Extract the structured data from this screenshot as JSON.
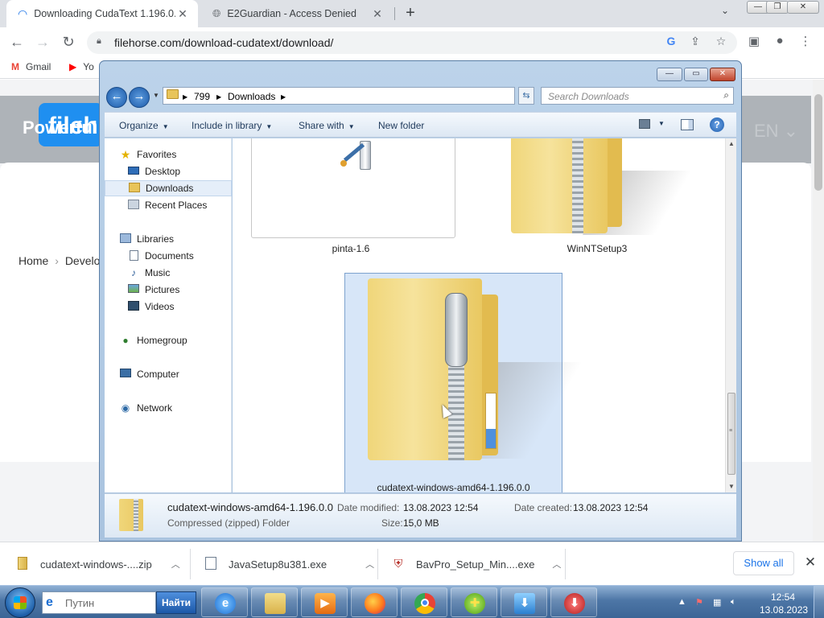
{
  "browser": {
    "tabs": [
      {
        "title": "Downloading CudaText 1.196.0.0",
        "close": "✕",
        "icon": "loading-spinner-icon"
      },
      {
        "title": "E2Guardian - Access Denied",
        "close": "✕",
        "icon": "globe-icon"
      }
    ],
    "new_tab": "+",
    "tab_dropdown": "⌄",
    "window_controls": {
      "minimize": "—",
      "maximize": "❐",
      "close": "✕"
    },
    "nav": {
      "back": "←",
      "forward": "→",
      "reload": "↻"
    },
    "url": "filehorse.com/download-cudatext/download/",
    "bookmarks": [
      {
        "label": "Gmail",
        "icon": "gmail-icon"
      },
      {
        "label": "Yo",
        "icon": "youtube-icon"
      }
    ]
  },
  "page_behind": {
    "logo": "fileh",
    "banner_text": "Powerful",
    "lang": "EN ⌄",
    "breadcrumb_home": "Home",
    "breadcrumb_next": "Develop"
  },
  "explorer": {
    "window_controls": {
      "minimize": "—",
      "maximize": "▭",
      "close": "✕"
    },
    "breadcrumb": [
      "799",
      "Downloads"
    ],
    "search_placeholder": "Search Downloads",
    "commands": [
      {
        "label": "Organize",
        "dropdown": true
      },
      {
        "label": "Include in library",
        "dropdown": true
      },
      {
        "label": "Share with",
        "dropdown": true
      },
      {
        "label": "New folder",
        "dropdown": false
      }
    ],
    "nav": {
      "favorites": {
        "label": "Favorites",
        "items": [
          "Desktop",
          "Downloads",
          "Recent Places"
        ]
      },
      "libraries": {
        "label": "Libraries",
        "items": [
          "Documents",
          "Music",
          "Pictures",
          "Videos"
        ]
      },
      "homegroup": "Homegroup",
      "computer": "Computer",
      "network": "Network"
    },
    "selected_nav": "Downloads",
    "files": [
      {
        "name": "pinta-1.6",
        "kind": "image-thumbnail"
      },
      {
        "name": "WinNTSetup3",
        "kind": "zip-folder"
      },
      {
        "name": "cudatext-windows-amd64-1.196.0.0",
        "kind": "zip-folder",
        "selected": true
      }
    ],
    "details": {
      "name": "cudatext-windows-amd64-1.196.0.0",
      "type": "Compressed (zipped) Folder",
      "date_modified_label": "Date modified:",
      "date_modified": "13.08.2023 12:54",
      "date_created_label": "Date created:",
      "date_created": "13.08.2023 12:54",
      "size_label": "Size:",
      "size": "15,0 MB"
    }
  },
  "downloads_shelf": {
    "items": [
      {
        "name": "cudatext-windows-....zip",
        "icon": "zip-file-icon"
      },
      {
        "name": "JavaSetup8u381.exe",
        "icon": "exe-file-icon"
      },
      {
        "name": "BavPro_Setup_Min....exe",
        "icon": "shield-exe-icon"
      }
    ],
    "show_all": "Show all",
    "close": "✕"
  },
  "taskbar": {
    "search_placeholder": "Путин",
    "search_button": "Найти",
    "apps": [
      "Internet Explorer",
      "Windows Explorer",
      "Media Player",
      "Firefox",
      "Chrome",
      "Add program",
      "Downloader",
      "Shield installer"
    ],
    "clock_time": "12:54",
    "clock_date": "13.08.2023"
  }
}
